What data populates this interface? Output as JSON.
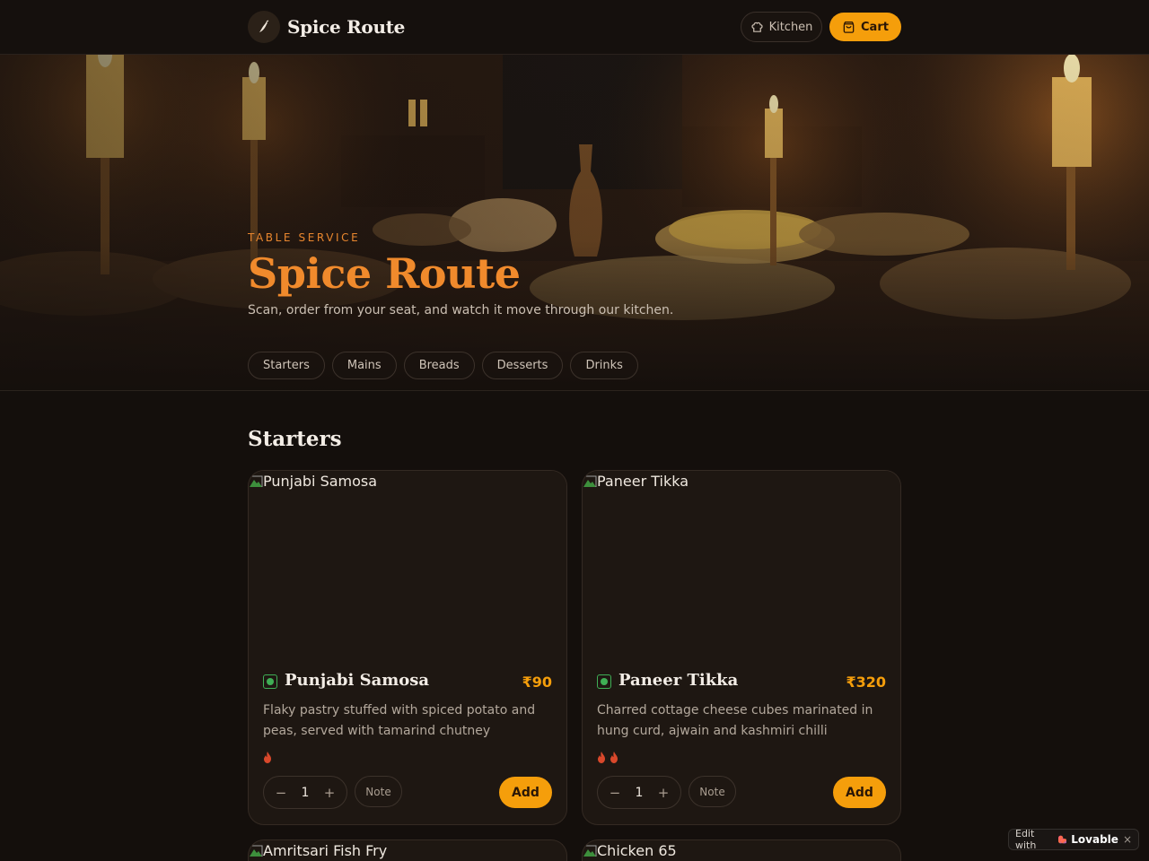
{
  "header": {
    "brand_name": "Spice Route",
    "kitchen_label": "Kitchen",
    "cart_label": "Cart"
  },
  "hero": {
    "eyebrow": "TABLE SERVICE",
    "title": "Spice Route",
    "subtitle": "Scan, order from your seat, and watch it move through our kitchen."
  },
  "categories": [
    "Starters",
    "Mains",
    "Breads",
    "Desserts",
    "Drinks"
  ],
  "section": {
    "title": "Starters"
  },
  "dishes": [
    {
      "image_alt": "Punjabi Samosa",
      "name": "Punjabi Samosa",
      "price": "₹90",
      "description": "Flaky pastry stuffed with spiced potato and peas, served with tamarind chutney",
      "spice_level": 1,
      "qty": "1",
      "note_label": "Note",
      "add_label": "Add"
    },
    {
      "image_alt": "Paneer Tikka",
      "name": "Paneer Tikka",
      "price": "₹320",
      "description": "Charred cottage cheese cubes marinated in hung curd, ajwain and kashmiri chilli",
      "spice_level": 2,
      "qty": "1",
      "note_label": "Note",
      "add_label": "Add"
    },
    {
      "image_alt": "Amritsari Fish Fry"
    },
    {
      "image_alt": "Chicken 65"
    }
  ],
  "badge": {
    "edit_label": "Edit with",
    "brand": "Lovable",
    "close": "×"
  },
  "colors": {
    "accent": "#f59e0b",
    "hero_title": "#f08a2c",
    "veg": "#3fae55",
    "spice": "#d9482b"
  }
}
